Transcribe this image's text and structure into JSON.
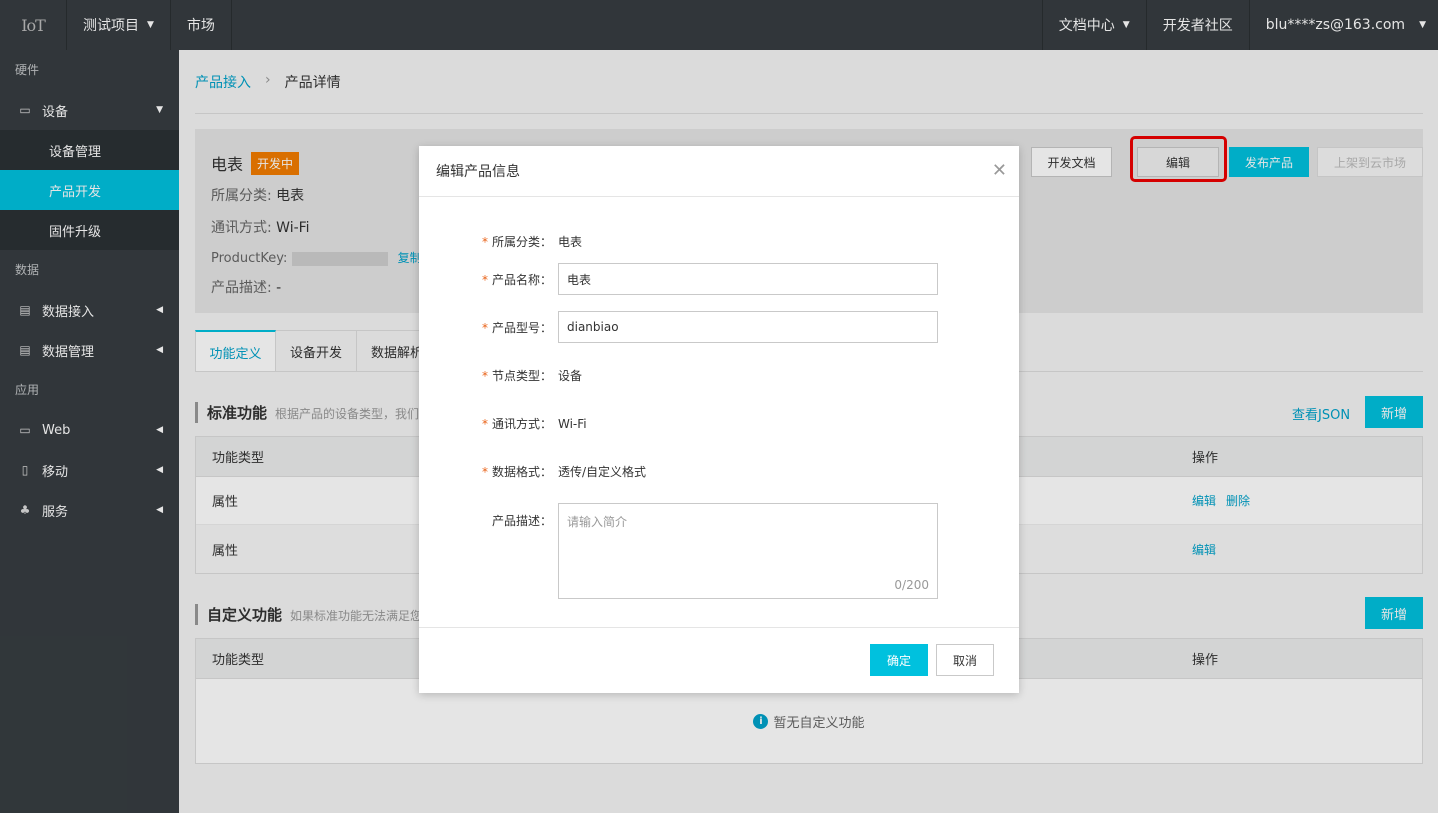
{
  "topbar": {
    "logo": "IoT",
    "project": "测试项目",
    "market": "市场",
    "docs": "文档中心",
    "community": "开发者社区",
    "account": "blu****zs@163.com"
  },
  "sidebar": {
    "section_hardware": "硬件",
    "device": "设备",
    "device_mgmt": "设备管理",
    "product_dev": "产品开发",
    "firmware": "固件升级",
    "section_data": "数据",
    "data_access": "数据接入",
    "data_mgmt": "数据管理",
    "section_app": "应用",
    "web": "Web",
    "mobile": "移动",
    "service": "服务"
  },
  "breadcrumb": {
    "parent": "产品接入",
    "current": "产品详情"
  },
  "product": {
    "name": "电表",
    "status": "开发中",
    "category_label": "所属分类:",
    "category": "电表",
    "comm_label": "通讯方式:",
    "comm": "Wi-Fi",
    "key_label": "ProductKey:",
    "copy": "复制",
    "desc_label": "产品描述:",
    "desc": "-"
  },
  "header_buttons": {
    "docs": "开发文档",
    "edit": "编辑",
    "publish": "发布产品",
    "market": "上架到云市场"
  },
  "tabs": [
    "功能定义",
    "设备开发",
    "数据解析"
  ],
  "standard": {
    "title": "标准功能",
    "desc": "根据产品的设备类型，我们",
    "json_link": "查看JSON",
    "add": "新增",
    "col_type": "功能类型",
    "col_ops": "操作",
    "rows": [
      {
        "type": "属性",
        "edit": "编辑",
        "delete": "删除"
      },
      {
        "type": "属性",
        "edit": "编辑"
      }
    ]
  },
  "custom": {
    "title": "自定义功能",
    "desc": "如果标准功能无法满足您",
    "add": "新增",
    "col_type": "功能类型",
    "col_ops": "操作",
    "empty": "暂无自定义功能"
  },
  "modal": {
    "title": "编辑产品信息",
    "category_label": "所属分类：",
    "category": "电表",
    "name_label": "产品名称：",
    "name_value": "电表",
    "model_label": "产品型号：",
    "model_value": "dianbiao",
    "node_label": "节点类型：",
    "node": "设备",
    "comm_label": "通讯方式：",
    "comm": "Wi-Fi",
    "format_label": "数据格式：",
    "format": "透传/自定义格式",
    "desc_label": "产品描述：",
    "desc_placeholder": "请输入简介",
    "desc_count": "0/200",
    "ok": "确定",
    "cancel": "取消"
  }
}
